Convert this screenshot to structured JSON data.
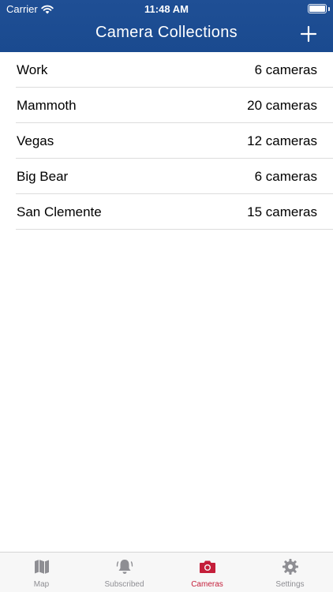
{
  "status_bar": {
    "carrier": "Carrier",
    "time": "11:48 AM"
  },
  "header": {
    "title": "Camera Collections",
    "background_color": "#1f4f95"
  },
  "collections": [
    {
      "name": "Work",
      "count": "6 cameras"
    },
    {
      "name": "Mammoth",
      "count": "20 cameras"
    },
    {
      "name": "Vegas",
      "count": "12 cameras"
    },
    {
      "name": "Big Bear",
      "count": "6 cameras"
    },
    {
      "name": "San Clemente",
      "count": "15 cameras"
    }
  ],
  "tab_bar": {
    "active_color": "#c41e3a",
    "inactive_color": "#8e8e93",
    "tabs": [
      {
        "label": "Map",
        "icon": "map-icon",
        "active": false
      },
      {
        "label": "Subscribed",
        "icon": "bell-icon",
        "active": false
      },
      {
        "label": "Cameras",
        "icon": "camera-icon",
        "active": true
      },
      {
        "label": "Settings",
        "icon": "gear-icon",
        "active": false
      }
    ]
  }
}
